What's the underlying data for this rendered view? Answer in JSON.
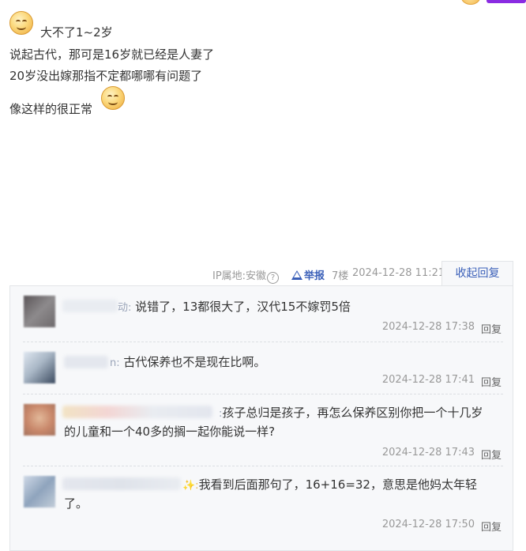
{
  "post": {
    "line1": "大不了1~2岁",
    "line2": "说起古代，那可是16岁就已经是人妻了",
    "line3": "20岁没出嫁那指不定都哪哪有问题了",
    "line4": "像这样的很正常",
    "emoji_icon": "grin-face-icon"
  },
  "meta": {
    "ip": "IP属地:安徽",
    "report": "举报",
    "floor": "7楼",
    "time": "2024-12-28 11:21",
    "collapse": "收起回复"
  },
  "replies": [
    {
      "suffix": "动:",
      "text": "说错了，13都很大了，汉代15不嫁罚5倍",
      "text2": "",
      "time": "2024-12-28 17:38",
      "reply": "回复"
    },
    {
      "suffix": "n:",
      "text": "古代保养也不是现在比啊。",
      "text2": "",
      "time": "2024-12-28 17:41",
      "reply": "回复"
    },
    {
      "suffix": ":",
      "text": "孩子总归是孩子，再怎么保养区别你把一个十几岁",
      "text2": "的儿童和一个40多的搁一起你能说一样?",
      "time": "2024-12-28 17:43",
      "reply": "回复"
    },
    {
      "suffix": "✨:",
      "text": "我看到后面那句了，16+16=32，意思是他妈太年轻",
      "text2": "了。",
      "time": "2024-12-28 17:50",
      "reply": "回复"
    }
  ],
  "colors": {
    "link": "#3a5fb8",
    "meta": "#999999",
    "text": "#333333",
    "reply_bg": "#f7f8fa"
  }
}
